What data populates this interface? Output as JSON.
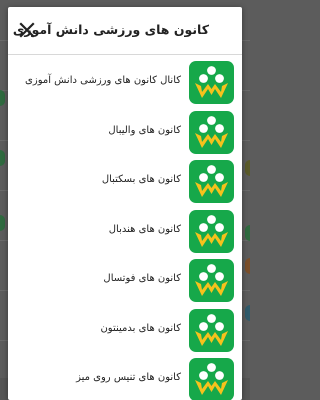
{
  "dialog": {
    "title": "کانون های ورزشی دانش آموزی",
    "close_icon": "close-icon"
  },
  "items": [
    {
      "label": "کانال کانون های ورزشی دانش آموزی",
      "icon": "club-logo-icon"
    },
    {
      "label": "کانون های والیبال",
      "icon": "club-logo-icon"
    },
    {
      "label": "کانون های بسکتبال",
      "icon": "club-logo-icon"
    },
    {
      "label": "کانون های هندبال",
      "icon": "club-logo-icon"
    },
    {
      "label": "کانون های فوتسال",
      "icon": "club-logo-icon"
    },
    {
      "label": "کانون های بدمینتون",
      "icon": "club-logo-icon"
    },
    {
      "label": "کانون های تنیس روی میز",
      "icon": "club-logo-icon"
    }
  ],
  "colors": {
    "logo_green": "#16a84a",
    "logo_yellow": "#f6c21c",
    "overlay": "#5c5c5c"
  }
}
